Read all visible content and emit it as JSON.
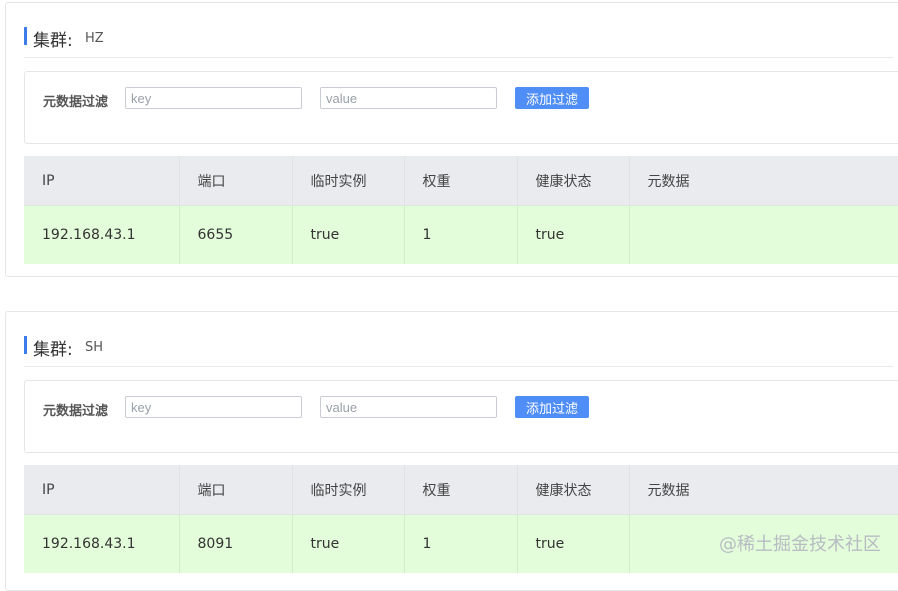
{
  "clusters": [
    {
      "label": "集群:",
      "name": "HZ",
      "filter": {
        "label": "元数据过滤",
        "key_placeholder": "key",
        "value_placeholder": "value",
        "button": "添加过滤"
      },
      "columns": [
        "IP",
        "端口",
        "临时实例",
        "权重",
        "健康状态",
        "元数据"
      ],
      "rows": [
        {
          "ip": "192.168.43.1",
          "port": "6655",
          "ephemeral": "true",
          "weight": "1",
          "healthy": "true",
          "metadata": ""
        }
      ]
    },
    {
      "label": "集群:",
      "name": "SH",
      "filter": {
        "label": "元数据过滤",
        "key_placeholder": "key",
        "value_placeholder": "value",
        "button": "添加过滤"
      },
      "columns": [
        "IP",
        "端口",
        "临时实例",
        "权重",
        "健康状态",
        "元数据"
      ],
      "rows": [
        {
          "ip": "192.168.43.1",
          "port": "8091",
          "ephemeral": "true",
          "weight": "1",
          "healthy": "true",
          "metadata": ""
        }
      ]
    }
  ],
  "watermark": "@稀土掘金技术社区",
  "colors": {
    "accent": "#3d7dea",
    "button": "#4f8ef7",
    "row_healthy": "#e3fcd9",
    "header_bg": "#e9ebef"
  }
}
